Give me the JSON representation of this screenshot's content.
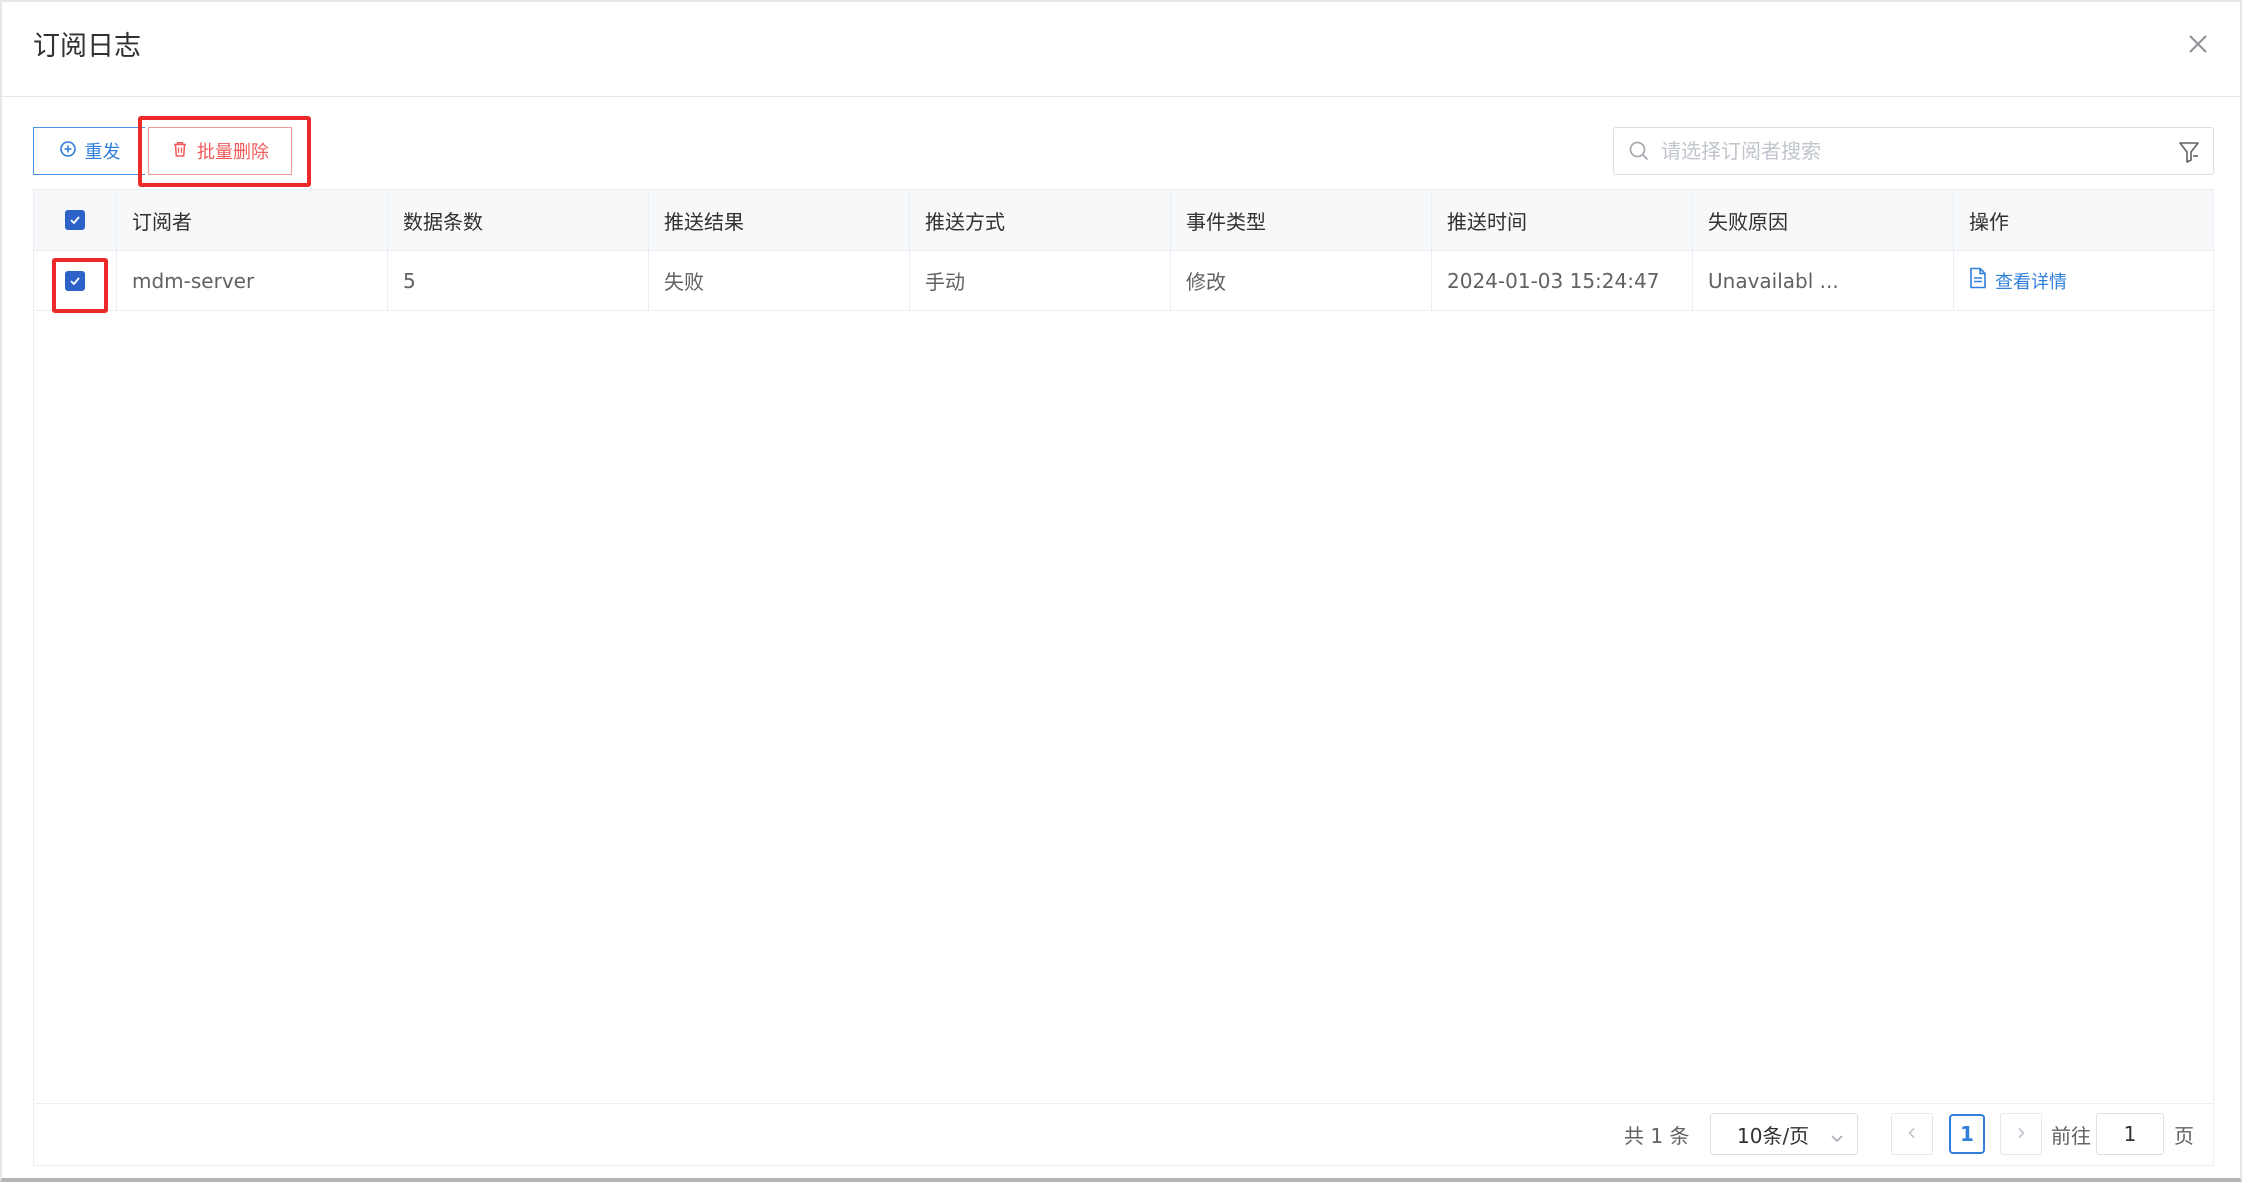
{
  "dialog": {
    "title": "订阅日志"
  },
  "toolbar": {
    "resend_label": "重发",
    "batch_delete_label": "批量删除"
  },
  "search": {
    "placeholder": "请选择订阅者搜索",
    "value": ""
  },
  "table": {
    "columns": [
      "订阅者",
      "数据条数",
      "推送结果",
      "推送方式",
      "事件类型",
      "推送时间",
      "失败原因",
      "操作"
    ],
    "rows": [
      {
        "subscriber": "mdm-server",
        "count": "5",
        "result": "失败",
        "method": "手动",
        "event_type": "修改",
        "push_time": "2024-01-03 15:24:47",
        "fail_reason": "Unavailabl ...",
        "action_label": "查看详情",
        "checked": true
      }
    ],
    "all_checked": true
  },
  "pagination": {
    "total_text": "共 1 条",
    "page_size": "10条/页",
    "current_page": "1",
    "goto_label": "前往",
    "goto_value": "1",
    "page_suffix": "页"
  },
  "colors": {
    "accent": "#2f7fdb",
    "danger": "#f05a5a",
    "highlight": "#ec2a2a",
    "checkbox": "#2d63c8"
  }
}
